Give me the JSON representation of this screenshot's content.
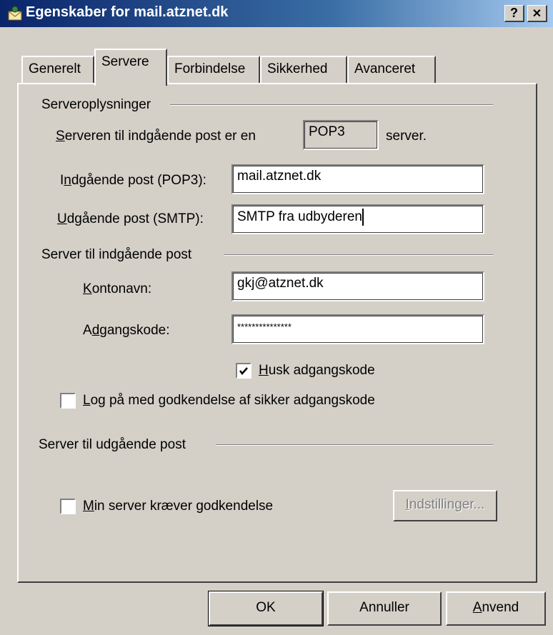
{
  "window": {
    "title": "Egenskaber for mail.atznet.dk",
    "help_glyph": "?",
    "close_glyph": "✕"
  },
  "tabs": [
    {
      "label": "Generelt"
    },
    {
      "label": "Servere",
      "active": true
    },
    {
      "label": "Forbindelse"
    },
    {
      "label": "Sikkerhed"
    },
    {
      "label": "Avanceret"
    }
  ],
  "server_info": {
    "group_label": "Serveroplysninger",
    "incoming_type_prefix": "erveren til indgående post er en",
    "incoming_type_prefix_mnemonic": "S",
    "incoming_type_value": "POP3",
    "incoming_type_suffix": "server.",
    "incoming_label_pre": "I",
    "incoming_label_mnemonic": "n",
    "incoming_label_post": "dgående post (POP3):",
    "incoming_value": "mail.atznet.dk",
    "outgoing_label_mnemonic": "U",
    "outgoing_label_post": "dgående post (SMTP):",
    "outgoing_value": "SMTP fra udbyderen"
  },
  "incoming_server": {
    "group_label": "Server til indgående post",
    "account_label_mnemonic": "K",
    "account_label_post": "ontonavn:",
    "account_value": "gkj@atznet.dk",
    "password_label_pre": "A",
    "password_label_mnemonic": "d",
    "password_label_post": "gangskode:",
    "password_value": "***************",
    "remember_mnemonic": "H",
    "remember_label": "usk adgangskode",
    "remember_checked": true,
    "spa_mnemonic": "L",
    "spa_label": "og på med godkendelse af sikker adgangskode",
    "spa_checked": false
  },
  "outgoing_server": {
    "group_label": "Server til udgående post",
    "auth_mnemonic": "M",
    "auth_label": "in server kræver godkendelse",
    "auth_checked": false,
    "settings_mnemonic": "I",
    "settings_label": "ndstillinger..."
  },
  "buttons": {
    "ok": "OK",
    "cancel": "Annuller",
    "apply_mnemonic": "A",
    "apply": "nvend"
  }
}
